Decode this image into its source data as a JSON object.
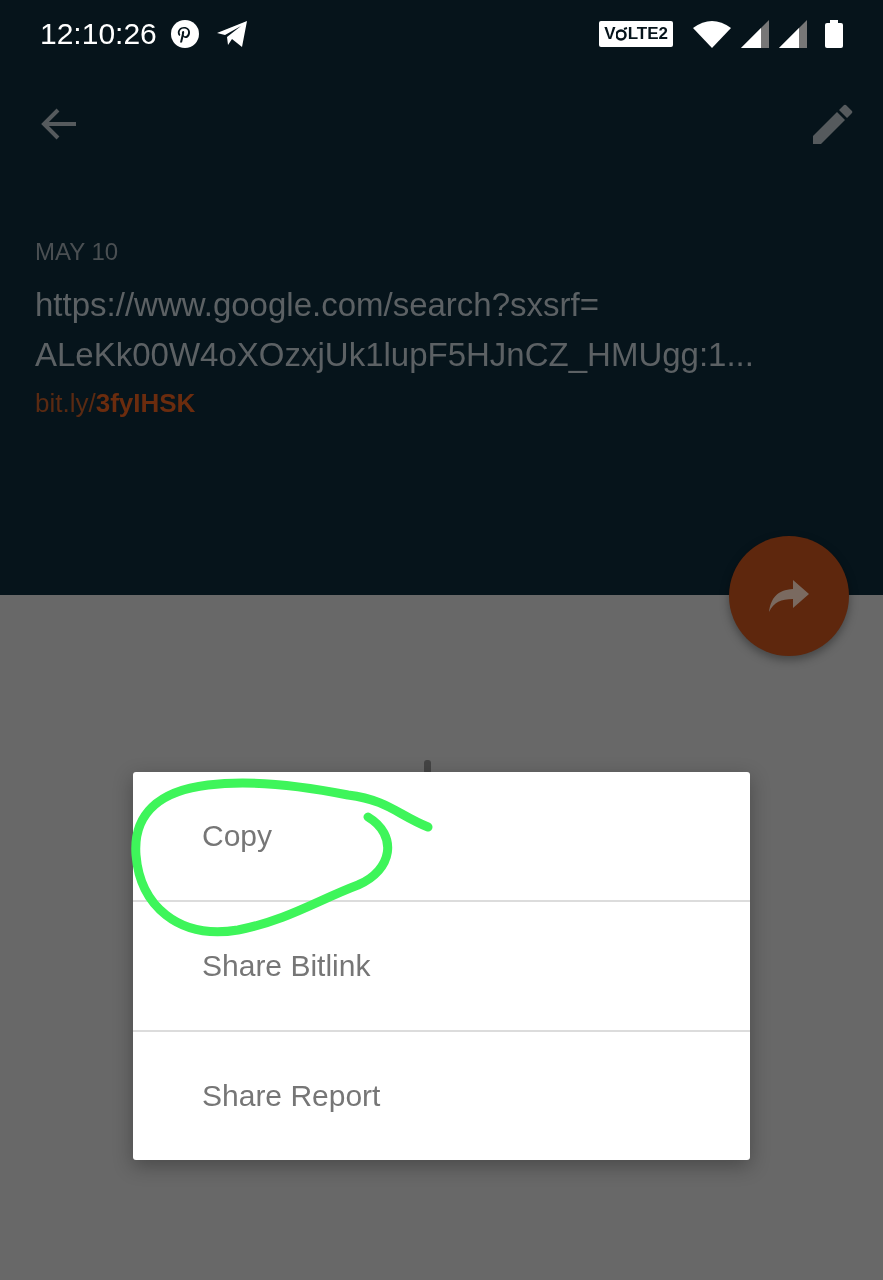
{
  "status_bar": {
    "time": "12:10:26",
    "network_badge_prefix": "V",
    "network_badge_suffix": "LTE2"
  },
  "link": {
    "date": "MAY 10",
    "url_lines": [
      "https://www.google.com/search?sxsrf=",
      "ALeKk00W4oXOzxjUk1lupF5HJnCZ_HMUgg:1..."
    ],
    "short_link": "bit.ly/**3fyIHSK**"
  },
  "menu": {
    "items": [
      {
        "label": "Copy"
      },
      {
        "label": "Share Bitlink"
      },
      {
        "label": "Share Report"
      }
    ]
  }
}
